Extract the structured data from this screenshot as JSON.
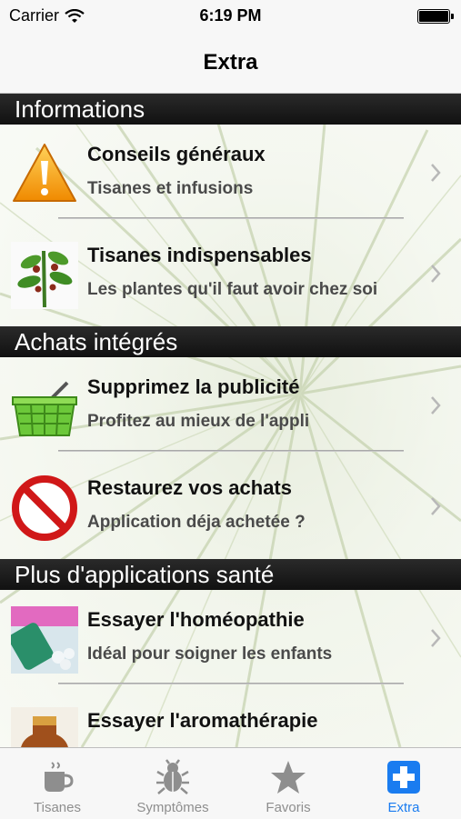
{
  "status_bar": {
    "carrier": "Carrier",
    "time": "6:19 PM"
  },
  "nav": {
    "title": "Extra"
  },
  "sections": [
    {
      "header": "Informations",
      "rows": [
        {
          "icon": "warning-icon",
          "title": "Conseils généraux",
          "subtitle": "Tisanes et infusions"
        },
        {
          "icon": "plant-icon",
          "title": "Tisanes indispensables",
          "subtitle": "Les plantes qu'il faut avoir chez soi"
        }
      ]
    },
    {
      "header": "Achats intégrés",
      "rows": [
        {
          "icon": "basket-icon",
          "title": "Supprimez la publicité",
          "subtitle": "Profitez au mieux de l'appli"
        },
        {
          "icon": "no-entry-icon",
          "title": "Restaurez vos achats",
          "subtitle": "Application déja achetée ?"
        }
      ]
    },
    {
      "header": "Plus d'applications santé",
      "rows": [
        {
          "icon": "homeopathy-icon",
          "title": "Essayer l'homéopathie",
          "subtitle": "Idéal pour soigner les enfants"
        },
        {
          "icon": "aromatherapy-icon",
          "title": "Essayer l'aromathérapie",
          "subtitle": ""
        }
      ]
    }
  ],
  "tabs": [
    {
      "label": "Tisanes",
      "icon": "cup-icon",
      "active": false
    },
    {
      "label": "Symptômes",
      "icon": "bug-icon",
      "active": false
    },
    {
      "label": "Favoris",
      "icon": "star-icon",
      "active": false
    },
    {
      "label": "Extra",
      "icon": "plus-icon",
      "active": true
    }
  ],
  "colors": {
    "accent": "#1a7cf0",
    "header_bg": "#1a1a1a",
    "tab_inactive": "#8e8e8e"
  }
}
